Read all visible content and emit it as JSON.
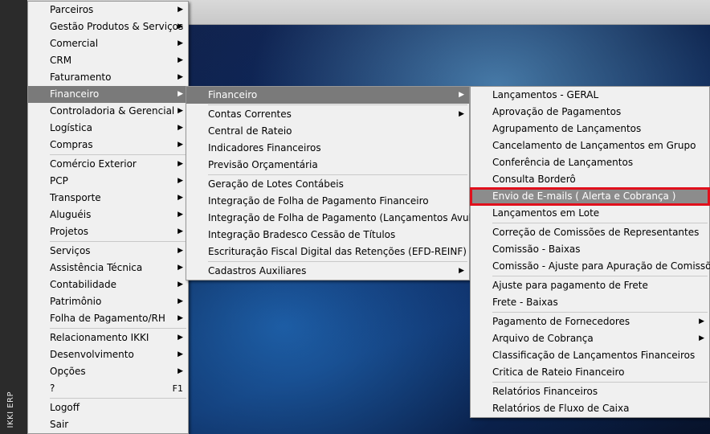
{
  "app": {
    "side_label": "IKKI ERP"
  },
  "main_menu": {
    "items": [
      {
        "label": "Parceiros",
        "submenu": true
      },
      {
        "label": "Gestão Produtos & Serviços",
        "submenu": true
      },
      {
        "label": "Comercial",
        "submenu": true
      },
      {
        "label": "CRM",
        "submenu": true
      },
      {
        "label": "Faturamento",
        "submenu": true
      },
      {
        "label": "Financeiro",
        "submenu": true,
        "active": true
      },
      {
        "label": "Controladoria & Gerencial",
        "submenu": true
      },
      {
        "label": "Logística",
        "submenu": true
      },
      {
        "label": "Compras",
        "submenu": true
      },
      {
        "label": "Comércio Exterior",
        "submenu": true
      },
      {
        "label": "PCP",
        "submenu": true
      },
      {
        "label": "Transporte",
        "submenu": true
      },
      {
        "label": "Aluguéis",
        "submenu": true
      },
      {
        "label": "Projetos",
        "submenu": true
      },
      {
        "label": "Serviços",
        "submenu": true
      },
      {
        "label": "Assistência Técnica",
        "submenu": true
      },
      {
        "label": "Contabilidade",
        "submenu": true
      },
      {
        "label": "Patrimônio",
        "submenu": true
      },
      {
        "label": "Folha de Pagamento/RH",
        "submenu": true
      },
      {
        "label": "Relacionamento IKKI",
        "submenu": true
      },
      {
        "label": "Desenvolvimento",
        "submenu": true
      },
      {
        "label": "Opções",
        "submenu": true
      },
      {
        "label": "?",
        "shortcut": "F1"
      },
      {
        "label": "Logoff"
      },
      {
        "label": "Sair"
      }
    ]
  },
  "financeiro_menu": {
    "items": [
      {
        "label": "Financeiro",
        "submenu": true,
        "active": true
      },
      {
        "label": "Contas Correntes",
        "submenu": true
      },
      {
        "label": "Central de Rateio"
      },
      {
        "label": "Indicadores Financeiros"
      },
      {
        "label": "Previsão Orçamentária"
      },
      {
        "label": "Geração de Lotes Contábeis"
      },
      {
        "label": "Integração de Folha de Pagamento Financeiro"
      },
      {
        "label": "Integração de Folha de Pagamento (Lançamentos Avulsos)"
      },
      {
        "label": "Integração Bradesco Cessão de Títulos"
      },
      {
        "label": "Escrituração Fiscal Digital das Retenções (EFD-REINF)"
      },
      {
        "label": "Cadastros Auxiliares",
        "submenu": true
      }
    ]
  },
  "financeiro_sub_menu": {
    "items": [
      {
        "label": "Lançamentos - GERAL"
      },
      {
        "label": "Aprovação de Pagamentos"
      },
      {
        "label": "Agrupamento de Lançamentos"
      },
      {
        "label": "Cancelamento de Lançamentos em Grupo"
      },
      {
        "label": "Conferência de Lançamentos"
      },
      {
        "label": "Consulta Borderô"
      },
      {
        "label": "Envio de E-mails ( Alerta e Cobrança )",
        "highlighted": true
      },
      {
        "label": "Lançamentos em Lote"
      },
      {
        "label": "Correção de Comissões de Representantes"
      },
      {
        "label": "Comissão - Baixas"
      },
      {
        "label": "Comissão - Ajuste para Apuração de Comissões"
      },
      {
        "label": "Ajuste para pagamento de Frete"
      },
      {
        "label": "Frete - Baixas"
      },
      {
        "label": "Pagamento de Fornecedores",
        "submenu": true
      },
      {
        "label": "Arquivo de Cobrança",
        "submenu": true
      },
      {
        "label": "Classificação de Lançamentos Financeiros"
      },
      {
        "label": "Critica de Rateio Financeiro"
      },
      {
        "label": "Relatórios Financeiros"
      },
      {
        "label": "Relatórios de Fluxo de Caixa"
      }
    ]
  },
  "colors": {
    "menu_bg": "#f0f0f0",
    "hover_bg": "#91c9f7",
    "highlight_border": "#e0101c",
    "highlight_bg": "#8c8c8c"
  }
}
